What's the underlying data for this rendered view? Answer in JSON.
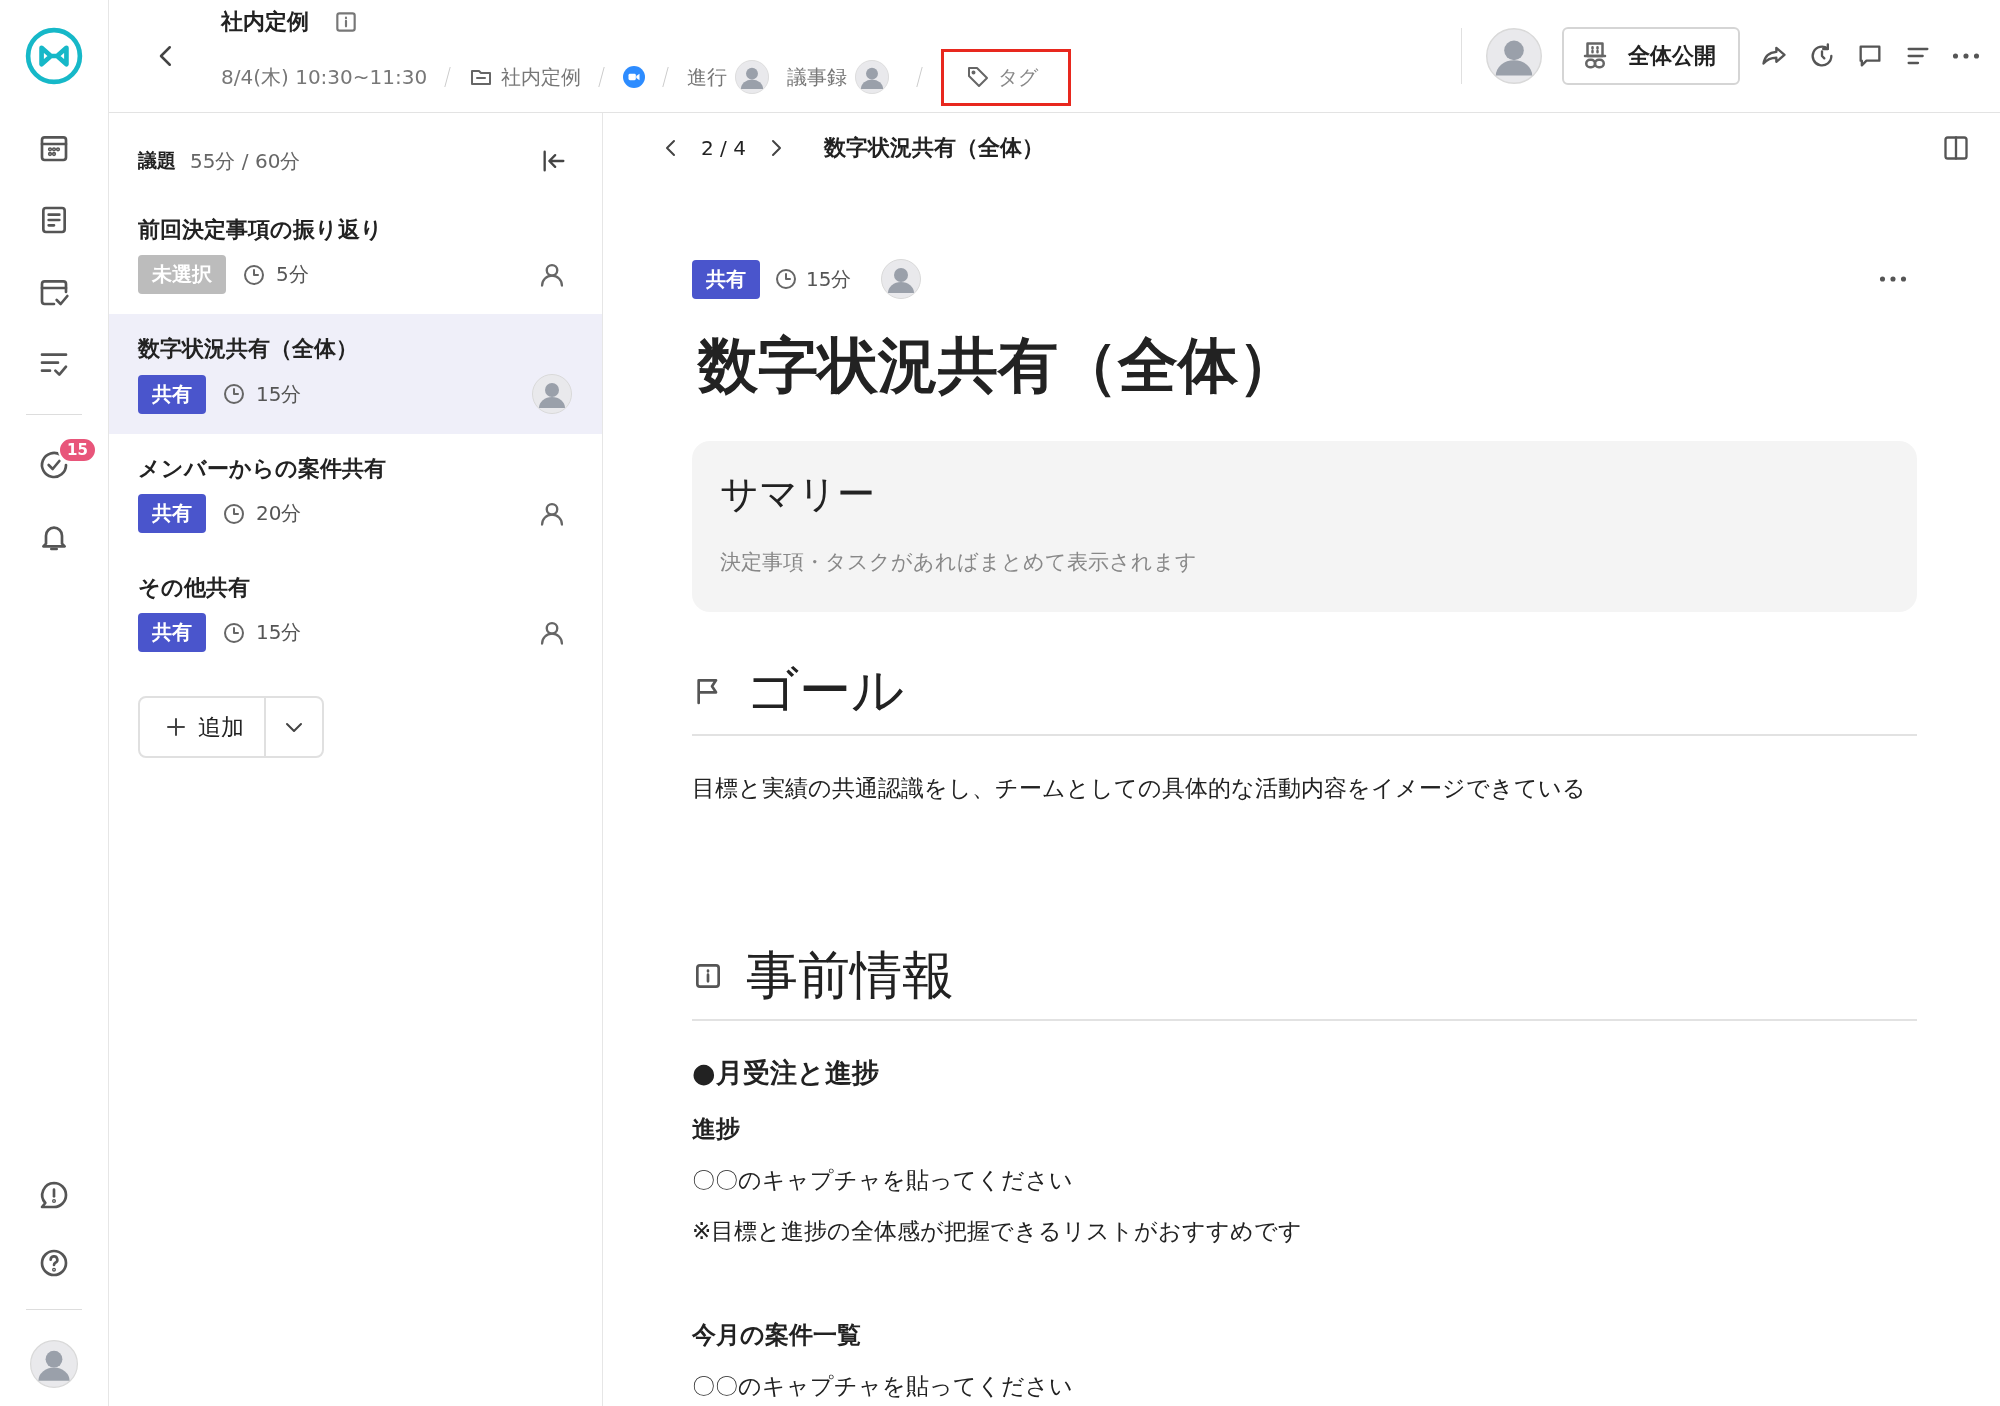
{
  "rail": {
    "task_badge": "15"
  },
  "header": {
    "title": "社内定例",
    "datetime": "8/4(木) 10:30~11:30",
    "folder": "社内定例",
    "facilitator_label": "進行",
    "minutes_label": "議事録",
    "tag_placeholder": "タグ",
    "tag_highlighted": true,
    "visibility_button": "全体公開"
  },
  "agenda": {
    "label": "議題",
    "time_summary": "55分 / 60分",
    "add_button": "追加",
    "items": [
      {
        "title": "前回決定事項の振り返り",
        "status": "未選択",
        "color": "#bcbcbc",
        "duration": "5分",
        "assigned": false,
        "selected": false
      },
      {
        "title": "数字状況共有（全体）",
        "status": "共有",
        "color": "#4a55cc",
        "duration": "15分",
        "assigned": true,
        "selected": true
      },
      {
        "title": "メンバーからの案件共有",
        "status": "共有",
        "color": "#4a55cc",
        "duration": "20分",
        "assigned": false,
        "selected": false
      },
      {
        "title": "その他共有",
        "status": "共有",
        "color": "#4a55cc",
        "duration": "15分",
        "assigned": false,
        "selected": false
      }
    ]
  },
  "main": {
    "pager": "2 / 4",
    "page_title": "数字状況共有（全体）",
    "status": "共有",
    "color": "#4a55cc",
    "duration": "15分",
    "heading": "数字状況共有（全体）",
    "summary": {
      "title": "サマリー",
      "note": "決定事項・タスクがあればまとめて表示されます"
    },
    "sections": [
      {
        "kind": "goal",
        "heading": "ゴール",
        "blocks": [
          {
            "kind": "text",
            "text": "目標と実績の共通認識をし、チームとしての具体的な活動内容をイメージできている"
          }
        ]
      },
      {
        "kind": "info",
        "heading": "事前情報",
        "blocks": [
          {
            "kind": "title",
            "text": "●月受注と進捗"
          },
          {
            "kind": "subtitle",
            "text": "進捗"
          },
          {
            "kind": "text",
            "text": "〇〇のキャプチャを貼ってください"
          },
          {
            "kind": "text",
            "text": "※目標と進捗の全体感が把握できるリストがおすすめです"
          },
          {
            "kind": "subtitle",
            "text": "今月の案件一覧"
          },
          {
            "kind": "text",
            "text": "〇〇のキャプチャを貼ってください"
          }
        ]
      }
    ]
  }
}
